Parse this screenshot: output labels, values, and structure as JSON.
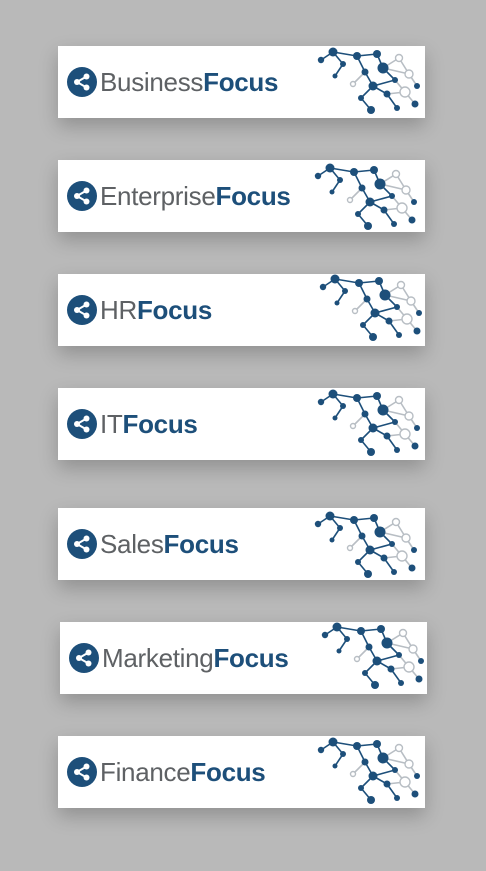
{
  "colors": {
    "brand": "#1d4f7a",
    "text": "#5e6164",
    "background": "#b9b9b9",
    "card": "#ffffff"
  },
  "banners": [
    {
      "light": "Business",
      "bold": "Focus",
      "icon": "share-icon"
    },
    {
      "light": "Enterprise",
      "bold": "Focus",
      "icon": "share-icon"
    },
    {
      "light": "HR",
      "bold": "Focus",
      "icon": "share-icon"
    },
    {
      "light": "IT",
      "bold": "Focus",
      "icon": "share-icon"
    },
    {
      "light": "Sales",
      "bold": "Focus",
      "icon": "share-icon"
    },
    {
      "light": "Marketing",
      "bold": "Focus",
      "icon": "share-icon"
    },
    {
      "light": "Finance",
      "bold": "Focus",
      "icon": "share-icon"
    }
  ]
}
